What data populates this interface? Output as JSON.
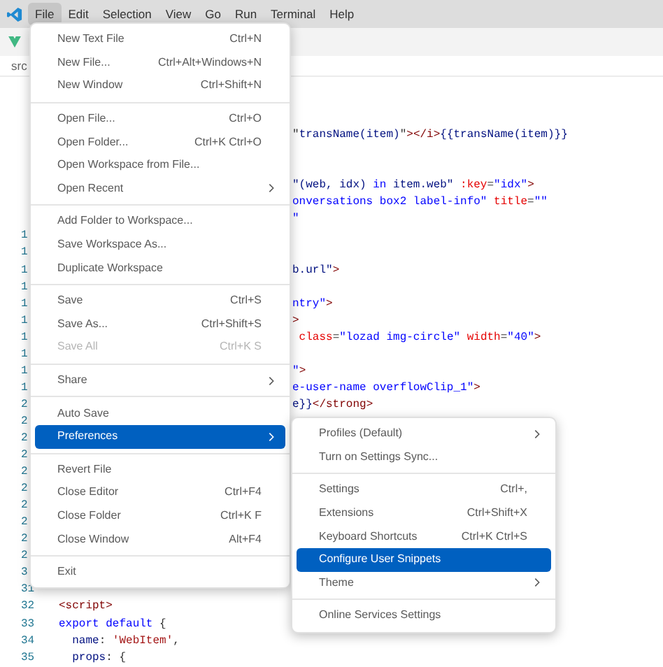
{
  "menubar": [
    {
      "label": "File",
      "selected": true
    },
    {
      "label": "Edit",
      "selected": false
    },
    {
      "label": "Selection",
      "selected": false
    },
    {
      "label": "View",
      "selected": false
    },
    {
      "label": "Go",
      "selected": false
    },
    {
      "label": "Run",
      "selected": false
    },
    {
      "label": "Terminal",
      "selected": false
    },
    {
      "label": "Help",
      "selected": false
    }
  ],
  "breadcrumb": "src",
  "editor_lines": [
    {
      "kind": "blank"
    },
    {
      "kind": "blank"
    },
    {
      "kind": "blank"
    },
    {
      "kind": "clipped",
      "tokens": [
        {
          "text": "\"",
          "kind": "plain"
        },
        {
          "text": "transName(item)",
          "kind": "var"
        },
        {
          "text": "\"",
          "kind": "plain"
        },
        {
          "text": "></i>",
          "kind": "tag"
        },
        {
          "text": "{{transName(item)}}",
          "kind": "var"
        }
      ]
    },
    {
      "kind": "blank"
    },
    {
      "kind": "blank"
    },
    {
      "kind": "clipped",
      "tokens": [
        {
          "text": "\"(web, idx) ",
          "kind": "var"
        },
        {
          "text": "in",
          "kind": "keyword"
        },
        {
          "text": " item.web\" ",
          "kind": "var"
        },
        {
          "text": ":key",
          "kind": "attr"
        },
        {
          "text": "=",
          "kind": "plain"
        },
        {
          "text": "\"idx\"",
          "kind": "string"
        },
        {
          "text": ">",
          "kind": "tag"
        }
      ]
    },
    {
      "kind": "clipped",
      "tokens": [
        {
          "text": "onversations box2 label-info\" ",
          "kind": "string"
        },
        {
          "text": "title",
          "kind": "attr"
        },
        {
          "text": "=",
          "kind": "plain"
        },
        {
          "text": "\"\"",
          "kind": "string"
        }
      ]
    },
    {
      "kind": "clipped",
      "tokens": [
        {
          "text": "\"",
          "kind": "string"
        }
      ]
    },
    {
      "kind": "gutter",
      "number": "1"
    },
    {
      "kind": "gutter",
      "number": "1"
    },
    {
      "kind": "clipped",
      "number": "1",
      "tokens": [
        {
          "text": "b.url\"",
          "kind": "var"
        },
        {
          "text": ">",
          "kind": "tag"
        }
      ]
    },
    {
      "kind": "gutter",
      "number": "1"
    },
    {
      "kind": "clipped",
      "number": "1",
      "tokens": [
        {
          "text": "ntry\"",
          "kind": "string"
        },
        {
          "text": ">",
          "kind": "tag"
        }
      ]
    },
    {
      "kind": "clipped",
      "number": "1",
      "tokens": [
        {
          "text": ">",
          "kind": "tag"
        }
      ]
    },
    {
      "kind": "clipped",
      "number": "1",
      "tokens": [
        {
          "text": " class",
          "kind": "attr"
        },
        {
          "text": "=",
          "kind": "plain"
        },
        {
          "text": "\"lozad img-circle\" ",
          "kind": "string"
        },
        {
          "text": "width",
          "kind": "attr"
        },
        {
          "text": "=",
          "kind": "plain"
        },
        {
          "text": "\"40\"",
          "kind": "string"
        },
        {
          "text": ">",
          "kind": "tag"
        }
      ]
    },
    {
      "kind": "gutter",
      "number": "1"
    },
    {
      "kind": "clipped",
      "number": "1",
      "tokens": [
        {
          "text": "\"",
          "kind": "string"
        },
        {
          "text": ">",
          "kind": "tag"
        }
      ]
    },
    {
      "kind": "clipped",
      "number": "1",
      "tokens": [
        {
          "text": "e-user-name overflowClip_1\"",
          "kind": "string"
        },
        {
          "text": ">",
          "kind": "tag"
        }
      ]
    },
    {
      "kind": "clipped",
      "number": "2",
      "tokens": [
        {
          "text": "e}}",
          "kind": "var"
        },
        {
          "text": "</strong>",
          "kind": "tag"
        }
      ]
    },
    {
      "kind": "gutter",
      "number": "2"
    },
    {
      "kind": "gutter",
      "number": "2"
    },
    {
      "kind": "gutter",
      "number": "2"
    },
    {
      "kind": "gutter",
      "number": "2"
    },
    {
      "kind": "gutter",
      "number": "2"
    },
    {
      "kind": "gutter",
      "number": "2"
    },
    {
      "kind": "gutter",
      "number": "2"
    },
    {
      "kind": "gutter",
      "number": "2"
    },
    {
      "kind": "gutter",
      "number": "2"
    },
    {
      "kind": "gutter",
      "number": "3"
    },
    {
      "kind": "gutter",
      "number": "31"
    },
    {
      "kind": "full",
      "number": "32",
      "tokens": [
        {
          "text": "<script>",
          "kind": "tag"
        }
      ]
    },
    {
      "kind": "full",
      "number": "33",
      "tokens": [
        {
          "text": "export ",
          "kind": "keyword"
        },
        {
          "text": "default",
          "kind": "keyword"
        },
        {
          "text": " {",
          "kind": "plain"
        }
      ]
    },
    {
      "kind": "full",
      "number": "34",
      "tokens": [
        {
          "text": "  name",
          "kind": "var"
        },
        {
          "text": ": ",
          "kind": "plain"
        },
        {
          "text": "'WebItem'",
          "kind": "quote"
        },
        {
          "text": ",",
          "kind": "plain"
        }
      ]
    },
    {
      "kind": "full",
      "number": "35",
      "tokens": [
        {
          "text": "  props",
          "kind": "var"
        },
        {
          "text": ": {",
          "kind": "plain"
        }
      ]
    }
  ],
  "file_menu": [
    [
      {
        "label": "New Text File",
        "shortcut": "Ctrl+N",
        "has_submenu": false,
        "disabled": false,
        "selected": false
      },
      {
        "label": "New File...",
        "shortcut": "Ctrl+Alt+Windows+N",
        "has_submenu": false,
        "disabled": false,
        "selected": false
      },
      {
        "label": "New Window",
        "shortcut": "Ctrl+Shift+N",
        "has_submenu": false,
        "disabled": false,
        "selected": false
      }
    ],
    [
      {
        "label": "Open File...",
        "shortcut": "Ctrl+O",
        "has_submenu": false,
        "disabled": false,
        "selected": false
      },
      {
        "label": "Open Folder...",
        "shortcut": "Ctrl+K Ctrl+O",
        "has_submenu": false,
        "disabled": false,
        "selected": false
      },
      {
        "label": "Open Workspace from File...",
        "has_submenu": false,
        "disabled": false,
        "selected": false
      },
      {
        "label": "Open Recent",
        "has_submenu": true,
        "disabled": false,
        "selected": false
      }
    ],
    [
      {
        "label": "Add Folder to Workspace...",
        "has_submenu": false,
        "disabled": false,
        "selected": false
      },
      {
        "label": "Save Workspace As...",
        "has_submenu": false,
        "disabled": false,
        "selected": false
      },
      {
        "label": "Duplicate Workspace",
        "has_submenu": false,
        "disabled": false,
        "selected": false
      }
    ],
    [
      {
        "label": "Save",
        "shortcut": "Ctrl+S",
        "has_submenu": false,
        "disabled": false,
        "selected": false
      },
      {
        "label": "Save As...",
        "shortcut": "Ctrl+Shift+S",
        "has_submenu": false,
        "disabled": false,
        "selected": false
      },
      {
        "label": "Save All",
        "shortcut": "Ctrl+K S",
        "has_submenu": false,
        "disabled": true,
        "selected": false
      }
    ],
    [
      {
        "label": "Share",
        "has_submenu": true,
        "disabled": false,
        "selected": false
      }
    ],
    [
      {
        "label": "Auto Save",
        "has_submenu": false,
        "disabled": false,
        "selected": false
      },
      {
        "label": "Preferences",
        "has_submenu": true,
        "disabled": false,
        "selected": true
      }
    ],
    [
      {
        "label": "Revert File",
        "has_submenu": false,
        "disabled": false,
        "selected": false
      },
      {
        "label": "Close Editor",
        "shortcut": "Ctrl+F4",
        "has_submenu": false,
        "disabled": false,
        "selected": false
      },
      {
        "label": "Close Folder",
        "shortcut": "Ctrl+K F",
        "has_submenu": false,
        "disabled": false,
        "selected": false
      },
      {
        "label": "Close Window",
        "shortcut": "Alt+F4",
        "has_submenu": false,
        "disabled": false,
        "selected": false
      }
    ],
    [
      {
        "label": "Exit",
        "has_submenu": false,
        "disabled": false,
        "selected": false
      }
    ]
  ],
  "preferences_submenu": [
    [
      {
        "label": "Profiles (Default)",
        "has_submenu": true,
        "disabled": false,
        "selected": false
      },
      {
        "label": "Turn on Settings Sync...",
        "has_submenu": false,
        "disabled": false,
        "selected": false
      }
    ],
    [
      {
        "label": "Settings",
        "shortcut": "Ctrl+,",
        "has_submenu": false,
        "disabled": false,
        "selected": false
      },
      {
        "label": "Extensions",
        "shortcut": "Ctrl+Shift+X",
        "has_submenu": false,
        "disabled": false,
        "selected": false
      },
      {
        "label": "Keyboard Shortcuts",
        "shortcut": "Ctrl+K Ctrl+S",
        "has_submenu": false,
        "disabled": false,
        "selected": false
      },
      {
        "label": "Configure User Snippets",
        "has_submenu": false,
        "disabled": false,
        "selected": true
      },
      {
        "label": "Theme",
        "has_submenu": true,
        "disabled": false,
        "selected": false
      }
    ],
    [
      {
        "label": "Online Services Settings",
        "has_submenu": false,
        "disabled": false,
        "selected": false
      }
    ]
  ]
}
